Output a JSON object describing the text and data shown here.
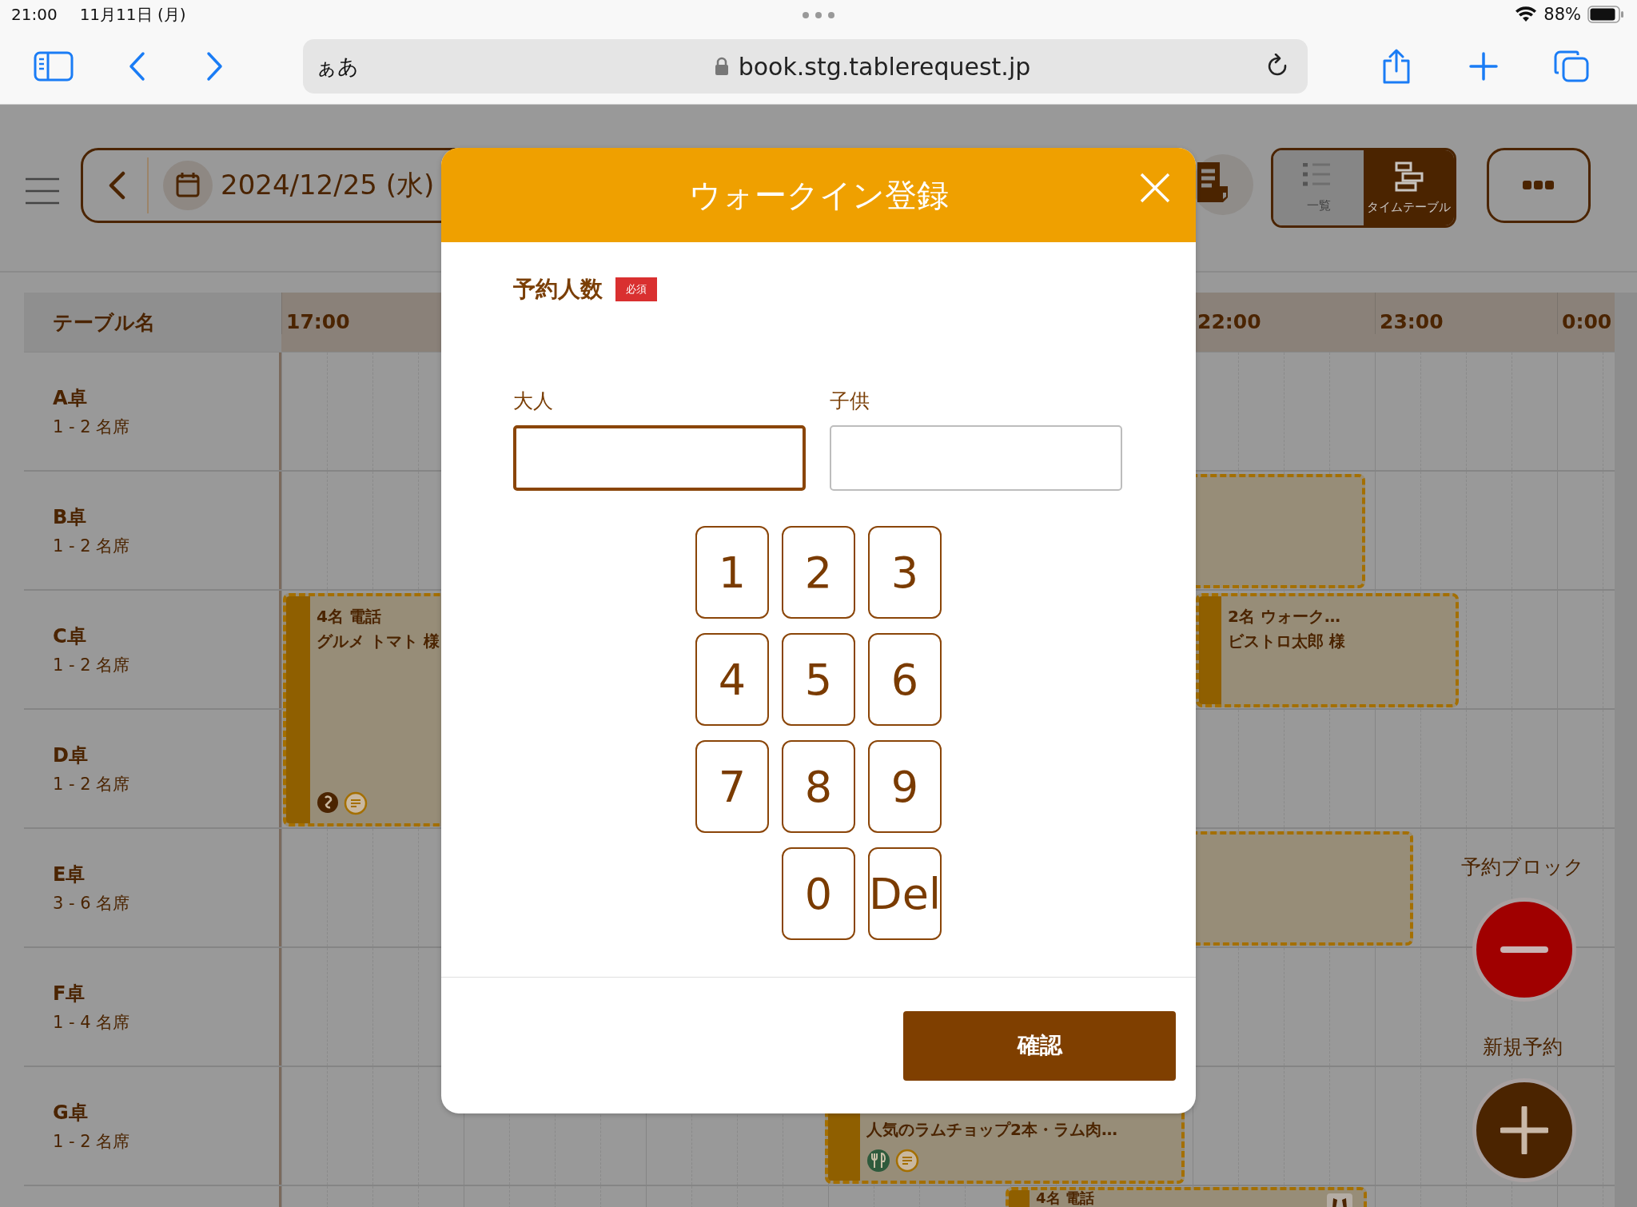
{
  "status_bar": {
    "time": "21:00",
    "date": "11月11日 (月)",
    "battery": "88%"
  },
  "browser": {
    "text_size": "ぁあ",
    "url": "book.stg.tablerequest.jp"
  },
  "app": {
    "date": "2024/12/25 (水)",
    "view_toggle": [
      {
        "label": "一覧",
        "selected": false
      },
      {
        "label": "タイムテーブル",
        "selected": true
      }
    ]
  },
  "timeline": {
    "header": "テーブル名",
    "hours": [
      "17:00",
      "22:00",
      "23:00",
      "0:00"
    ],
    "rows": [
      {
        "name": "A卓",
        "seats": "1 - 2 名席"
      },
      {
        "name": "B卓",
        "seats": "1 - 2 名席"
      },
      {
        "name": "C卓",
        "seats": "1 - 2 名席"
      },
      {
        "name": "D卓",
        "seats": "1 - 2 名席"
      },
      {
        "name": "E卓",
        "seats": "3 - 6 名席"
      },
      {
        "name": "F卓",
        "seats": "1 - 4 名席"
      },
      {
        "name": "G卓",
        "seats": "1 - 2 名席"
      }
    ],
    "reservations": [
      {
        "lines": [
          "4名 電話",
          "グルメ トマト 様"
        ]
      },
      {
        "lines": [
          "2名 ウォーク…",
          "ビストロ太郎 様"
        ]
      },
      {
        "lines": [
          "人気のラムチョップ2本・ラム肉…"
        ]
      },
      {
        "lines": [
          "4名 電話"
        ]
      }
    ]
  },
  "actions": [
    {
      "label": "予約ブロック",
      "kind": "block"
    },
    {
      "label": "新規予約",
      "kind": "new"
    }
  ],
  "modal": {
    "title": "ウォークイン登録",
    "section": "予約人数",
    "required_badge": "必須",
    "fields": [
      {
        "label": "大人",
        "focused": true
      },
      {
        "label": "子供",
        "focused": false
      }
    ],
    "keypad": [
      "1",
      "2",
      "3",
      "4",
      "5",
      "6",
      "7",
      "8",
      "9",
      "0",
      "Del"
    ],
    "confirm": "確認"
  }
}
